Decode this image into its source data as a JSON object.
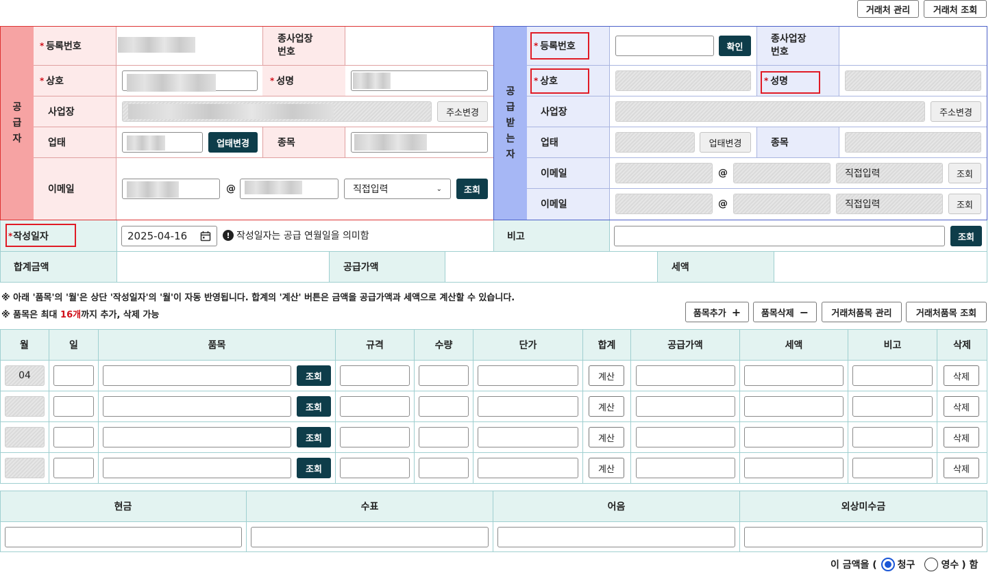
{
  "top_buttons": {
    "partner_manage": "거래처 관리",
    "partner_lookup": "거래처 조회"
  },
  "supplier": {
    "side_label": [
      "공",
      "급",
      "자"
    ],
    "reg_no_label": "등록번호",
    "workplace_no_label_1": "종사업장",
    "workplace_no_label_2": "번호",
    "company_label": "상호",
    "name_label": "성명",
    "address_label": "사업장",
    "address_change": "주소변경",
    "biz_type_label": "업태",
    "biz_type_change": "업태변경",
    "item_label": "종목",
    "email_label": "이메일",
    "at": "@",
    "email_domain_select": "직접입력",
    "lookup": "조회"
  },
  "receiver": {
    "side_label": [
      "공",
      "급",
      "받",
      "는",
      "자"
    ],
    "reg_no_label": "등록번호",
    "confirm": "확인",
    "workplace_no_label_1": "종사업장",
    "workplace_no_label_2": "번호",
    "company_label": "상호",
    "name_label": "성명",
    "address_label": "사업장",
    "address_change": "주소변경",
    "biz_type_label": "업태",
    "biz_type_change": "업태변경",
    "item_label": "종목",
    "email_label": "이메일",
    "email2_label": "이메일",
    "at": "@",
    "direct_input": "직접입력",
    "lookup": "조회"
  },
  "date_row": {
    "label": "작성일자",
    "date_value": "2025-04-16",
    "notice": "작성일자는 공급 연월일을 의미함",
    "remark_label": "비고",
    "lookup": "조회"
  },
  "totals_row": {
    "total_label": "합계금액",
    "supply_label": "공급가액",
    "tax_label": "세액"
  },
  "notes": {
    "note1": "※ 아래 '품목'의 '월'은 상단 '작성일자'의 '월'이 자동 반영됩니다. 합계의 '계산' 버튼은 금액을 공급가액과 세액으로 계산할 수 있습니다.",
    "note2_prefix": "※ 품목은 최대 ",
    "note2_highlight": "16개",
    "note2_suffix": "까지 추가, 삭제 가능"
  },
  "item_buttons": {
    "add": "품목추가",
    "add_sym": "+",
    "delete": "품목삭제",
    "delete_sym": "−",
    "manage": "거래처품목 관리",
    "lookup": "거래처품목 조회"
  },
  "items_table": {
    "headers": [
      "월",
      "일",
      "품목",
      "규격",
      "수량",
      "단가",
      "합계",
      "공급가액",
      "세액",
      "비고",
      "삭제"
    ],
    "rows": [
      {
        "month": "04",
        "lookup": "조회",
        "calc": "계산",
        "delete": "삭제"
      },
      {
        "month": "",
        "lookup": "조회",
        "calc": "계산",
        "delete": "삭제"
      },
      {
        "month": "",
        "lookup": "조회",
        "calc": "계산",
        "delete": "삭제"
      },
      {
        "month": "",
        "lookup": "조회",
        "calc": "계산",
        "delete": "삭제"
      }
    ]
  },
  "payment_table": {
    "headers": [
      "현금",
      "수표",
      "어음",
      "외상미수금"
    ]
  },
  "footer": {
    "prefix": "이 금액을 (",
    "opt1": "청구",
    "opt2": "영수",
    "suffix": ") 함",
    "selected": "청구"
  },
  "colors": {
    "supplier_bg": "#fdeaea",
    "supplier_side": "#f6a3a3",
    "receiver_bg": "#e8ecfb",
    "receiver_side": "#a6b7f5",
    "teal_bg": "#e3f3f1",
    "dark_btn": "#0e3d4a"
  }
}
